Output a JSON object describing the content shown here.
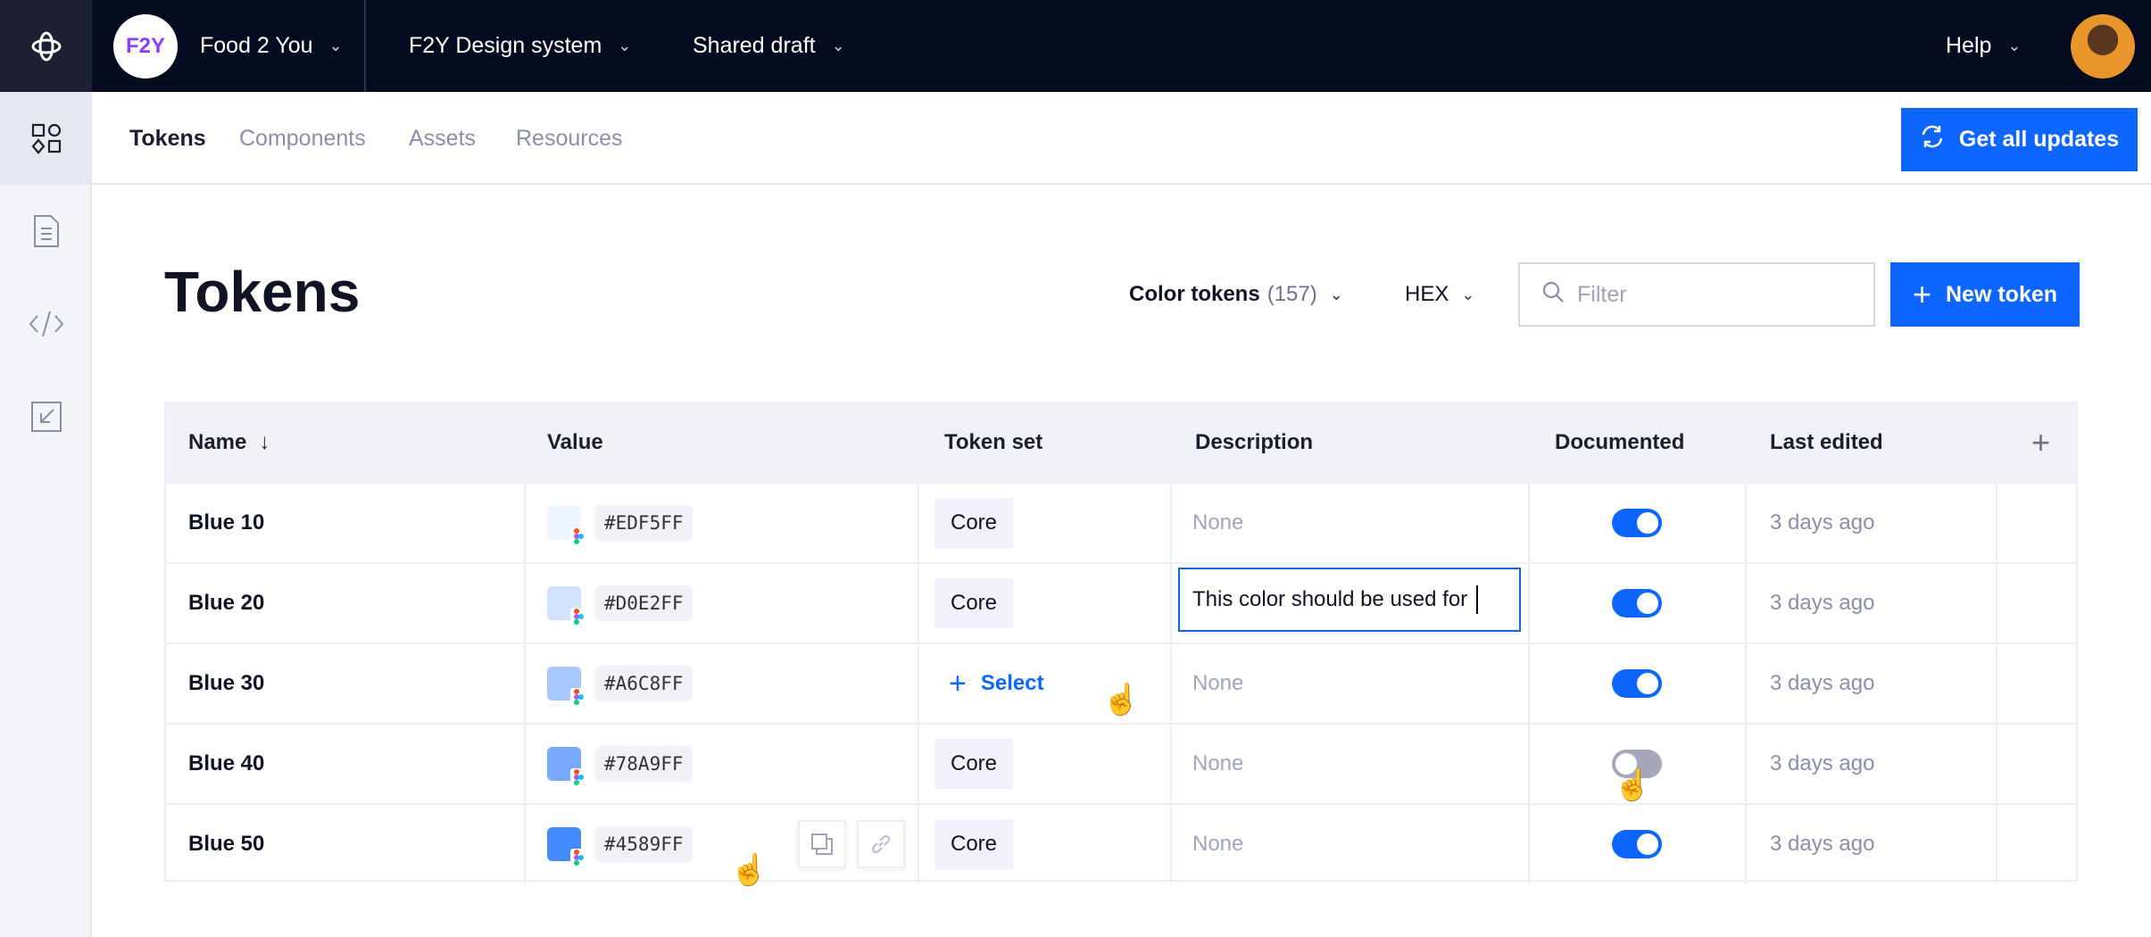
{
  "topbar": {
    "org_logo": "F2Y",
    "org": "Food 2 You",
    "project": "F2Y Design system",
    "branch": "Shared draft",
    "help": "Help"
  },
  "rail": [
    "components-icon",
    "document-icon",
    "code-icon",
    "import-icon"
  ],
  "subnav": {
    "tabs": [
      "Tokens",
      "Components",
      "Assets",
      "Resources"
    ],
    "active": "Tokens",
    "update_button": "Get all updates"
  },
  "page": {
    "title": "Tokens",
    "type_select": "Color tokens",
    "count": "(157)",
    "format_select": "HEX",
    "filter_placeholder": "Filter",
    "new_button": "New token"
  },
  "table": {
    "columns": [
      "Name",
      "Value",
      "Token set",
      "Description",
      "Documented",
      "Last edited"
    ],
    "sort": "Name descending arrow",
    "rows": [
      {
        "name": "Blue 10",
        "value": "#EDF5FF",
        "set": "Core",
        "description": "None",
        "documented": true,
        "edited": "3 days ago"
      },
      {
        "name": "Blue 20",
        "value": "#D0E2FF",
        "set": "Core",
        "description": "This color should be used for",
        "documented": true,
        "edited": "3 days ago"
      },
      {
        "name": "Blue 30",
        "value": "#A6C8FF",
        "set": "Select",
        "description": "None",
        "documented": true,
        "edited": "3 days ago"
      },
      {
        "name": "Blue 40",
        "value": "#78A9FF",
        "set": "Core",
        "description": "None",
        "documented": false,
        "edited": "3 days ago"
      },
      {
        "name": "Blue 50",
        "value": "#4589FF",
        "set": "Core",
        "description": "None",
        "documented": true,
        "edited": "3 days ago"
      }
    ]
  },
  "colors": {
    "accent": "#0d66ff",
    "topbar": "#050b1f"
  }
}
